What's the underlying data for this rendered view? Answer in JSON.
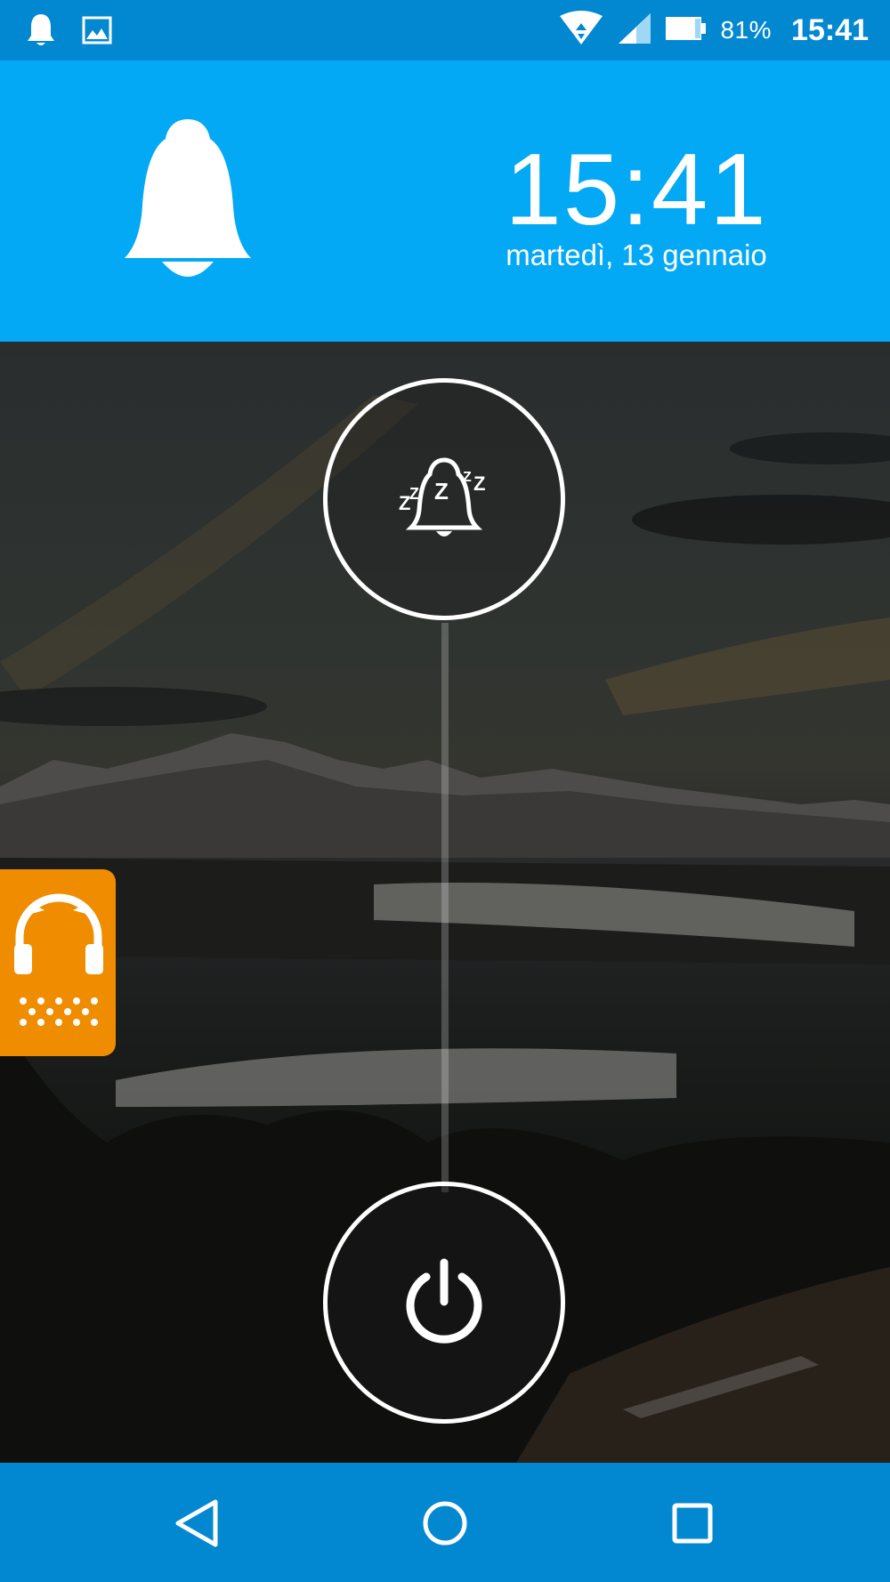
{
  "status_bar": {
    "battery_percent": "81%",
    "time": "15:41",
    "icons": [
      "notification-bell-icon",
      "image-icon",
      "wifi-icon",
      "cell-signal-icon",
      "battery-icon"
    ]
  },
  "header": {
    "time": "15:41",
    "date": "martedì, 13 gennaio",
    "icon": "alarm-bell-icon"
  },
  "actions": {
    "snooze_icon": "snooze-bell-icon",
    "dismiss_icon": "power-icon"
  },
  "side_widget": {
    "icon": "headphones-icon"
  },
  "nav_bar": {
    "icons": [
      "back-icon",
      "home-icon",
      "recents-icon"
    ]
  },
  "colors": {
    "status_bar": "#0288d1",
    "header": "#03a9f4",
    "side_widget": "#f08c00",
    "nav_bar": "#0288d1"
  }
}
